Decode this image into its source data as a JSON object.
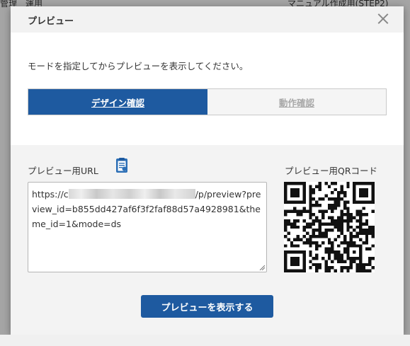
{
  "background": {
    "top_left_text": "管理　運用",
    "top_right_text": "マニュアル作成用(STEP2)"
  },
  "modal": {
    "title": "プレビュー",
    "close_icon": "close-icon",
    "instruction": "モードを指定してからプレビューを表示してください。",
    "mode_tabs": [
      {
        "label": "デザイン確認",
        "active": true
      },
      {
        "label": "動作確認",
        "active": false
      }
    ],
    "url_section": {
      "label": "プレビュー用URL",
      "copy_icon": "clipboard-icon",
      "url_prefix": "https://c",
      "url_suffix": "/p/preview?preview_id=b855dd427af6f3f2faf88d57a4928981&theme_id=1&mode=ds"
    },
    "qr_section": {
      "label": "プレビュー用QRコード"
    },
    "preview_button": "プレビューを表示する"
  },
  "colors": {
    "primary": "#1e5aa0",
    "overlay": "#000000",
    "inactive_tab_text": "#a8a8a8"
  }
}
